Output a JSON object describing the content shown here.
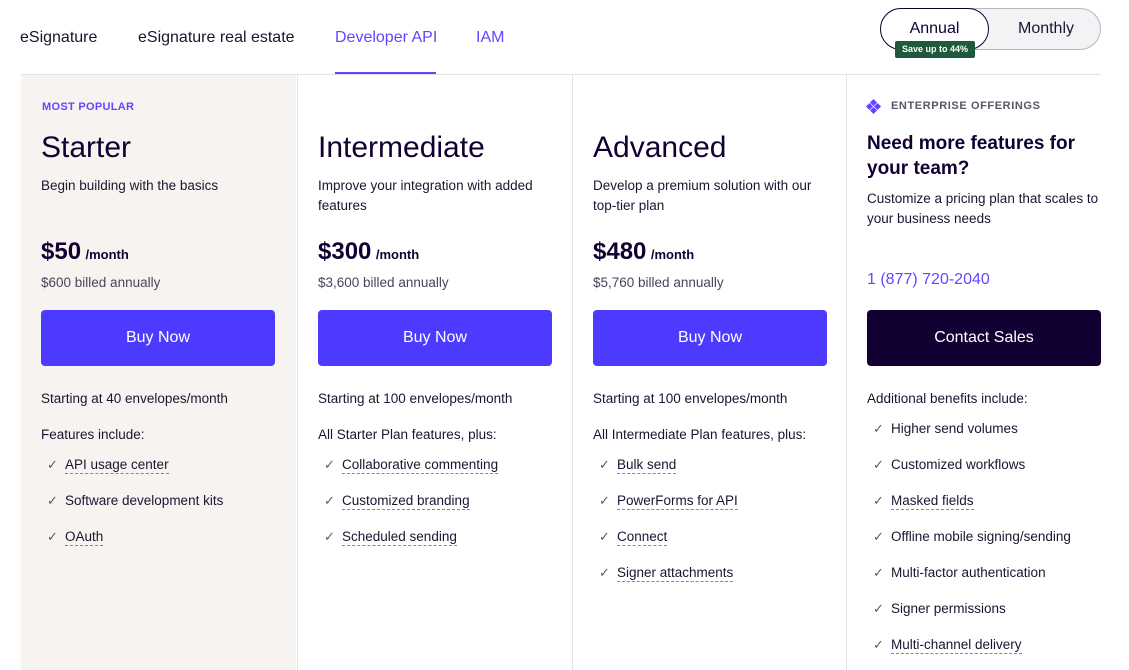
{
  "tabs": [
    {
      "label": "eSignature"
    },
    {
      "label": "eSignature real estate"
    },
    {
      "label": "Developer API"
    },
    {
      "label": "IAM"
    }
  ],
  "billing_toggle": {
    "annual": "Annual",
    "monthly": "Monthly",
    "save_badge": "Save up to 44%"
  },
  "plans": [
    {
      "badge": "MOST POPULAR",
      "name": "Starter",
      "description": "Begin building with the basics",
      "price": "$50",
      "per": "/month",
      "billed": "$600 billed annually",
      "button": "Buy Now",
      "starting": "Starting at 40 envelopes/month",
      "features_heading": "Features include:",
      "features": [
        "API usage center",
        "Software development kits",
        "OAuth"
      ]
    },
    {
      "name": "Intermediate",
      "description": "Improve your integration with added features",
      "price": "$300",
      "per": "/month",
      "billed": "$3,600 billed annually",
      "button": "Buy Now",
      "starting": "Starting at 100 envelopes/month",
      "features_heading": "All Starter Plan features, plus:",
      "features": [
        "Collaborative commenting",
        "Customized branding",
        "Scheduled sending"
      ]
    },
    {
      "name": "Advanced",
      "description": "Develop a premium solution with our top-tier plan",
      "price": "$480",
      "per": "/month",
      "billed": "$5,760 billed annually",
      "button": "Buy Now",
      "starting": "Starting at 100 envelopes/month",
      "features_heading": "All Intermediate Plan features, plus:",
      "features": [
        "Bulk send",
        "PowerForms for API",
        "Connect",
        "Signer attachments"
      ]
    }
  ],
  "enterprise": {
    "label": "ENTERPRISE OFFERINGS",
    "title": "Need more features for your team?",
    "description": "Customize a pricing plan that scales to your business needs",
    "phone": "1 (877) 720-2040",
    "button": "Contact Sales",
    "benefits_heading": "Additional benefits include:",
    "benefits": [
      "Higher send volumes",
      "Customized workflows",
      "Masked fields",
      "Offline mobile signing/sending",
      "Multi-factor authentication",
      "Signer permissions",
      "Multi-channel delivery"
    ]
  },
  "colors": {
    "accent": "#6445ff",
    "button_primary": "#4c3bff",
    "button_dark": "#130032",
    "badge_green": "#1e5a3b",
    "popular_bg": "#f7f3f0"
  }
}
